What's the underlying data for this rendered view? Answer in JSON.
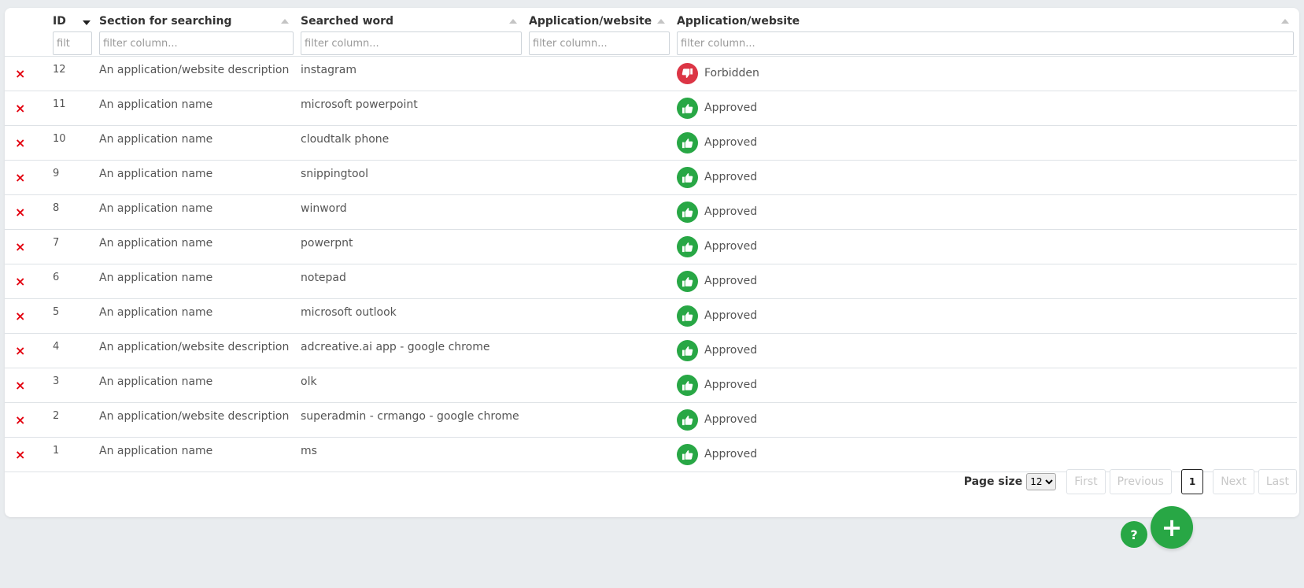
{
  "table": {
    "columns": [
      {
        "label": "ID",
        "filter_placeholder": "filt",
        "sort": "desc"
      },
      {
        "label": "Section for searching",
        "filter_placeholder": "filter column...",
        "sort": "none"
      },
      {
        "label": "Searched word",
        "filter_placeholder": "filter column...",
        "sort": "none"
      },
      {
        "label": "Application/website",
        "filter_placeholder": "filter column...",
        "sort": "none"
      },
      {
        "label": "Application/website",
        "filter_placeholder": "filter column...",
        "sort": "none"
      }
    ],
    "delete_icon": "×",
    "rows": [
      {
        "id": "12",
        "section": "An application/website description",
        "word": "instagram",
        "app": "",
        "status": "Forbidden",
        "status_icon": "thumbs-down-icon"
      },
      {
        "id": "11",
        "section": "An application name",
        "word": "microsoft powerpoint",
        "app": "",
        "status": "Approved",
        "status_icon": "thumbs-up-icon"
      },
      {
        "id": "10",
        "section": "An application name",
        "word": "cloudtalk phone",
        "app": "",
        "status": "Approved",
        "status_icon": "thumbs-up-icon"
      },
      {
        "id": "9",
        "section": "An application name",
        "word": "snippingtool",
        "app": "",
        "status": "Approved",
        "status_icon": "thumbs-up-icon"
      },
      {
        "id": "8",
        "section": "An application name",
        "word": "winword",
        "app": "",
        "status": "Approved",
        "status_icon": "thumbs-up-icon"
      },
      {
        "id": "7",
        "section": "An application name",
        "word": "powerpnt",
        "app": "",
        "status": "Approved",
        "status_icon": "thumbs-up-icon"
      },
      {
        "id": "6",
        "section": "An application name",
        "word": "notepad",
        "app": "",
        "status": "Approved",
        "status_icon": "thumbs-up-icon"
      },
      {
        "id": "5",
        "section": "An application name",
        "word": "microsoft outlook",
        "app": "",
        "status": "Approved",
        "status_icon": "thumbs-up-icon"
      },
      {
        "id": "4",
        "section": "An application/website description",
        "word": "adcreative.ai app - google chrome",
        "app": "",
        "status": "Approved",
        "status_icon": "thumbs-up-icon"
      },
      {
        "id": "3",
        "section": "An application name",
        "word": "olk",
        "app": "",
        "status": "Approved",
        "status_icon": "thumbs-up-icon"
      },
      {
        "id": "2",
        "section": "An application/website description",
        "word": "superadmin - crmango - google chrome",
        "app": "",
        "status": "Approved",
        "status_icon": "thumbs-up-icon"
      },
      {
        "id": "1",
        "section": "An application name",
        "word": "ms",
        "app": "",
        "status": "Approved",
        "status_icon": "thumbs-up-icon"
      }
    ]
  },
  "pagination": {
    "page_size_label": "Page size",
    "page_size_value": "12",
    "first": "First",
    "previous": "Previous",
    "current_page": "1",
    "next": "Next",
    "last": "Last"
  },
  "fab": {
    "help_label": "?",
    "add_label": "+"
  },
  "colors": {
    "approved": "#28a745",
    "forbidden": "#dc3545",
    "delete": "#e3000f"
  }
}
